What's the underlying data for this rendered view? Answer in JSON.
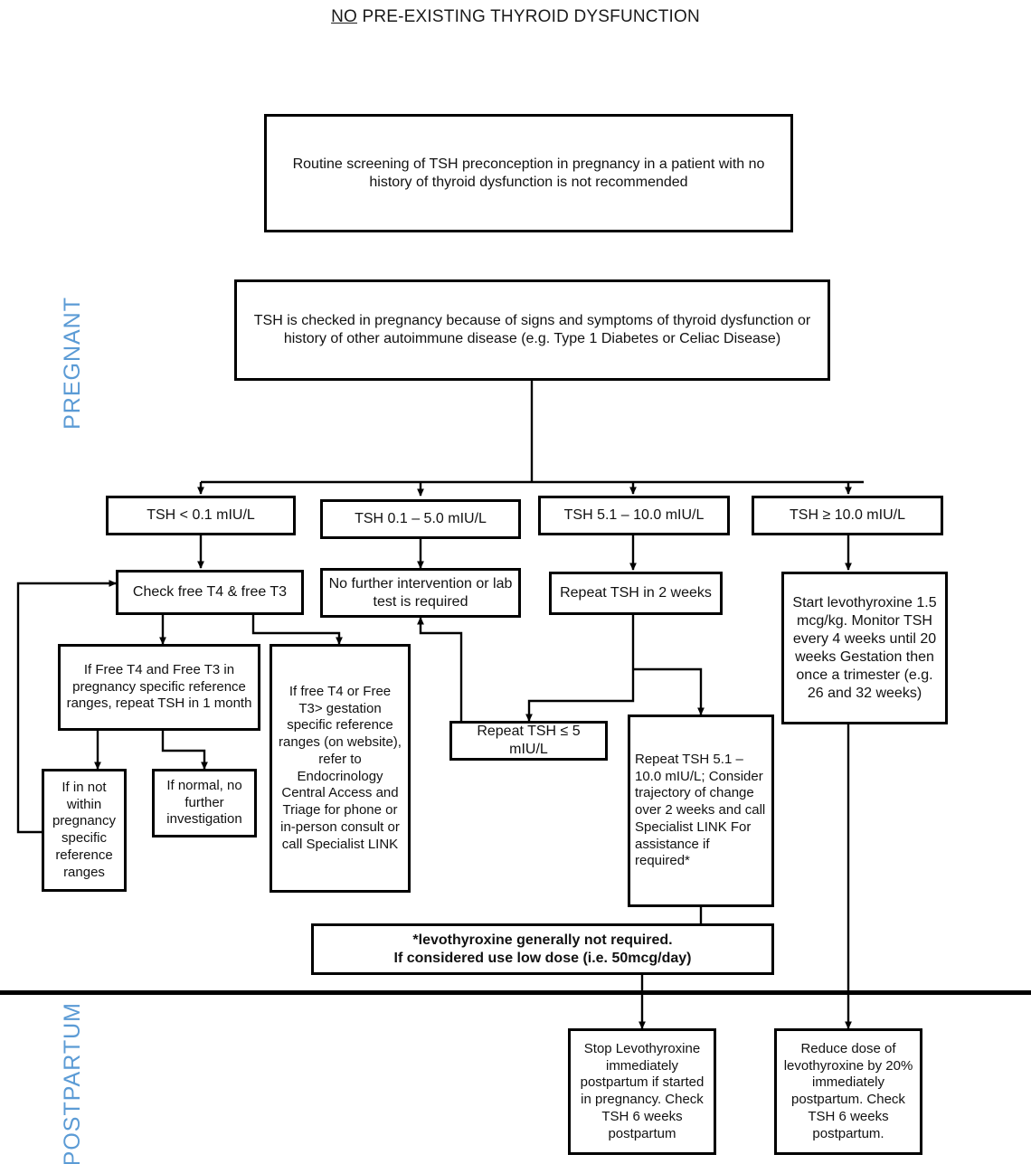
{
  "title": {
    "underlined": "NO",
    "rest": " PRE-EXISTING THYROID DYSFUNCTION"
  },
  "side_labels": {
    "pregnant": "PREGNANT",
    "postpartum": "POSTPARTUM"
  },
  "colors": {
    "side_label": "#5b9bd5",
    "box_border": "#000000",
    "text": "#111111",
    "background": "#ffffff"
  },
  "nodes": {
    "screening": "Routine screening of TSH preconception in pregnancy in a patient with no history of thyroid dysfunction is not recommended",
    "tsh_checked": "TSH is checked in pregnancy because of signs and symptoms of thyroid dysfunction or history of other autoimmune disease (e.g. Type 1 Diabetes or Celiac Disease)",
    "range_low": "TSH < 0.1 mIU/L",
    "range_normal": "TSH 0.1 – 5.0 mIU/L",
    "range_mid": "TSH 5.1 – 10.0 mIU/L",
    "range_high": "TSH ≥ 10.0 mIU/L",
    "check_free": "Check free T4 & free T3",
    "no_further": "No further intervention or lab test is required",
    "repeat_2wk": "Repeat TSH in 2 weeks",
    "start_levo": "Start levothyroxine 1.5 mcg/kg. Monitor TSH every 4 weeks until 20 weeks Gestation then once a trimester (e.g. 26 and 32 weeks)",
    "if_in_range": "If Free T4 and Free T3 in pregnancy specific reference ranges, repeat TSH in 1 month",
    "if_above_range": "If free T4 or Free T3> gestation specific reference ranges (on website), refer to Endocrinology Central Access and Triage for phone or in-person consult or call Specialist LINK",
    "if_not_within": "If in not within pregnancy specific reference ranges",
    "if_normal": "If normal, no further investigation",
    "repeat_le5": "Repeat TSH ≤ 5 mIU/L",
    "repeat_5_10": "Repeat TSH 5.1 – 10.0 mIU/L; Consider trajectory of change over 2 weeks and call Specialist LINK For assistance if required*",
    "footnote_line1": "*levothyroxine generally not required.",
    "footnote_line2": "If considered use low dose (i.e. 50mcg/day)",
    "stop_levo": "Stop Levothyroxine immediately postpartum if started in pregnancy. Check TSH 6 weeks postpartum",
    "reduce_levo": "Reduce dose of levothyroxine by 20% immediately postpartum. Check TSH 6 weeks postpartum."
  }
}
